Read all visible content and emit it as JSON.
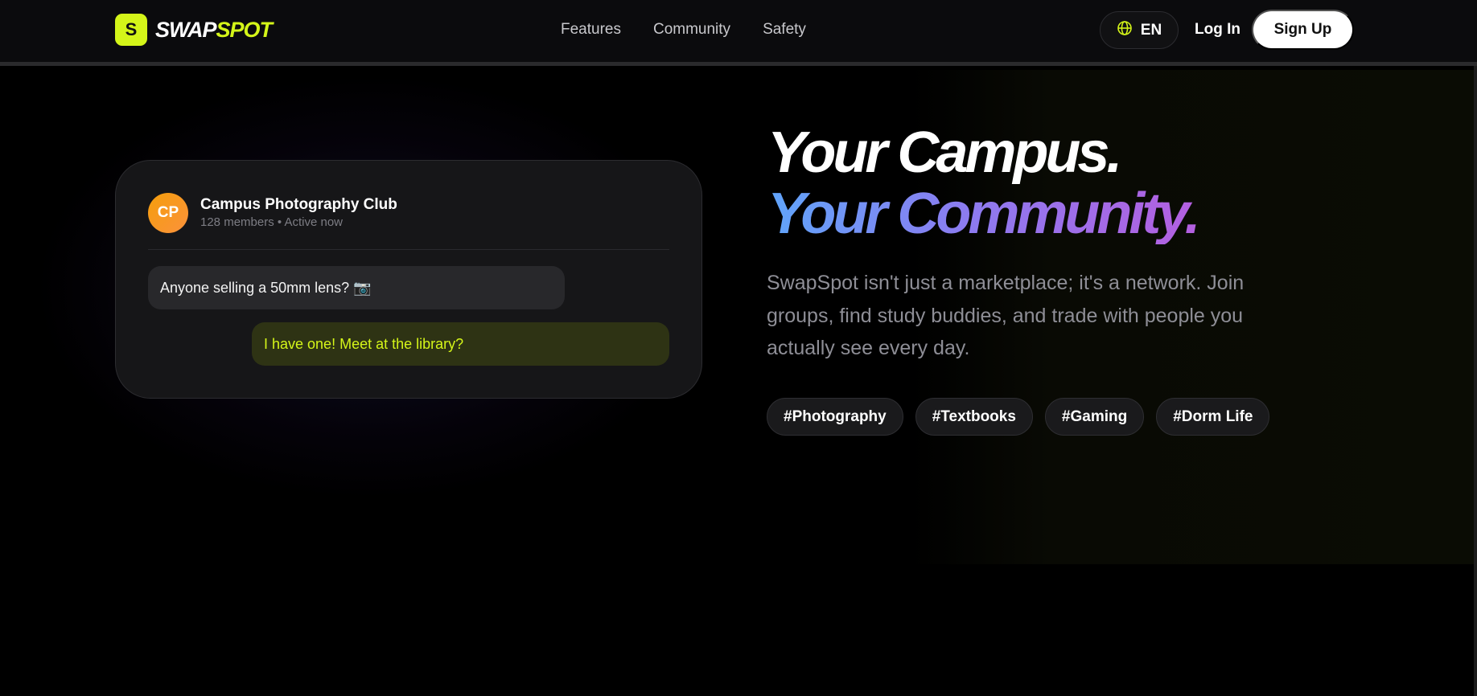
{
  "brand": {
    "mark_letter": "S",
    "name_part1": "SWAP",
    "name_part2": "SPOT",
    "accent_color": "#d4f519"
  },
  "nav": {
    "links": [
      "Features",
      "Community",
      "Safety"
    ],
    "language": {
      "icon": "globe-icon",
      "label": "EN"
    },
    "login_label": "Log In",
    "signup_label": "Sign Up"
  },
  "chat_card": {
    "avatar_initials": "CP",
    "group_name": "Campus Photography Club",
    "group_meta": "128 members • Active now",
    "messages": [
      {
        "direction": "incoming",
        "text": "Anyone selling a 50mm lens? 📷"
      },
      {
        "direction": "outgoing",
        "text": "I have one! Meet at the library?"
      }
    ]
  },
  "hero": {
    "headline_line1": "Your Campus.",
    "headline_line2": "Your Community.",
    "description": "SwapSpot isn't just a marketplace; it's a network. Join groups, find study buddies, and trade with people you actually see every day.",
    "tags": [
      "#Photography",
      "#Textbooks",
      "#Gaming",
      "#Dorm Life"
    ],
    "gradient_colors": [
      "#60a5fa",
      "#8b7cf0",
      "#b45fe0"
    ]
  }
}
